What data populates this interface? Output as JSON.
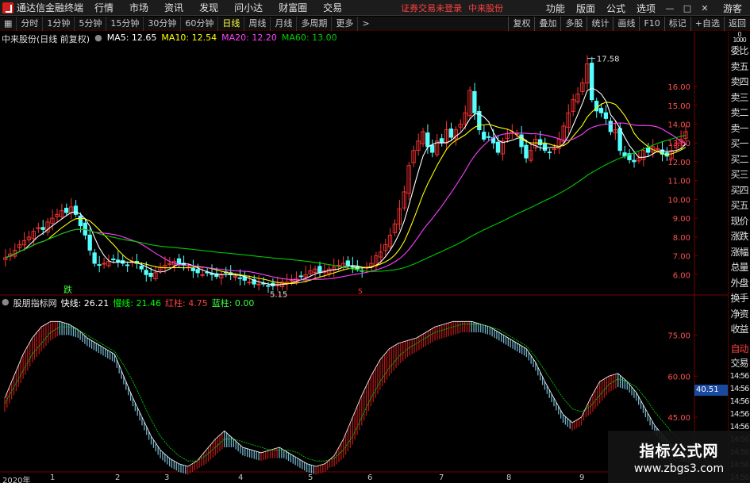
{
  "app": {
    "title": "通达信金融终端"
  },
  "menu": [
    "行情",
    "市场",
    "资讯",
    "发现",
    "问小达",
    "财富圈",
    "交易"
  ],
  "notice": {
    "account": "证券交易未登录",
    "stock": "中来股份"
  },
  "right_menu": [
    "功能",
    "版面",
    "公式",
    "选项"
  ],
  "guest": "游客",
  "periods": [
    "分时",
    "1分钟",
    "5分钟",
    "15分钟",
    "30分钟",
    "60分钟",
    "日线",
    "周线",
    "月线",
    "多周期",
    "更多"
  ],
  "active_period": "日线",
  "tools": [
    "复权",
    "叠加",
    "多股",
    "统计",
    "画线",
    "F10",
    "标记",
    "+自选",
    "返回"
  ],
  "main_legend": {
    "title": "中来股份(日线 前复权)",
    "ma5": "MA5: 12.65",
    "ma10": "MA10: 12.54",
    "ma20": "MA20: 12.20",
    "ma60": "MA60: 13.00"
  },
  "sub_legend": {
    "title": "股朋指标网",
    "fast": "快线: 26.21",
    "slow": "慢线: 21.46",
    "red": "红柱: 4.75",
    "blue": "蓝柱: 0.00"
  },
  "annotations": {
    "high": "17.58",
    "low": "5.15",
    "fall": "跌",
    "s_mark": "S"
  },
  "price_box": "40.51",
  "side_panel": {
    "top": "委比",
    "items": [
      "卖五",
      "卖四",
      "卖三",
      "卖二",
      "卖一",
      "买一",
      "买二",
      "买三",
      "买四",
      "买五",
      "现价",
      "涨跌",
      "涨幅",
      "总量",
      "外盘",
      "换手",
      "净资",
      "收益"
    ],
    "sub": [
      "自动",
      "交易",
      "14:56",
      "14:56",
      "14:56",
      "14:56",
      "14:56",
      "14:56",
      "14:56",
      "14:56",
      "14:56"
    ]
  },
  "side_top_values": [
    "0",
    "1000"
  ],
  "x_labels": [
    "2020年",
    "1",
    "2",
    "3",
    "4",
    "5",
    "6",
    "7",
    "8",
    "9"
  ],
  "watermark": {
    "title": "指标公式网",
    "url": "www.zbgs3.com"
  },
  "colors": {
    "up": "#ff3333",
    "down": "#54ffff",
    "ma5": "#ffffff",
    "ma10": "#ffff00",
    "ma20": "#ff40ff",
    "ma60": "#00cc00",
    "red_bar": "#b01818",
    "blue_bar": "#6fb0c8"
  },
  "chart_data": [
    {
      "type": "candlestick",
      "ylim": [
        5.15,
        17.58
      ],
      "y_ticks": [
        6.0,
        7.0,
        8.0,
        9.0,
        10.0,
        11.0,
        12.0,
        13.0,
        14.0,
        15.0,
        16.0
      ],
      "closes": [
        6.9,
        7.1,
        7.3,
        7.6,
        7.8,
        8.0,
        8.3,
        8.5,
        8.4,
        8.8,
        9.0,
        9.2,
        9.4,
        9.3,
        9.6,
        9.2,
        8.6,
        8.1,
        7.3,
        6.6,
        6.5,
        6.6,
        6.7,
        6.8,
        6.7,
        6.6,
        6.5,
        6.7,
        6.6,
        6.3,
        6.0,
        5.9,
        6.1,
        6.4,
        6.5,
        6.6,
        6.7,
        6.6,
        6.5,
        6.4,
        6.2,
        6.1,
        6.0,
        6.1,
        6.0,
        5.9,
        6.0,
        6.1,
        6.0,
        5.9,
        5.8,
        5.7,
        5.6,
        5.5,
        5.5,
        5.5,
        5.4,
        5.4,
        5.5,
        5.6,
        5.6,
        5.7,
        5.8,
        5.9,
        6.0,
        6.2,
        6.3,
        6.1,
        6.2,
        6.3,
        6.4,
        6.5,
        6.6,
        6.5,
        6.4,
        6.3,
        6.2,
        6.4,
        6.6,
        7.0,
        7.2,
        7.6,
        8.1,
        8.7,
        9.5,
        10.4,
        11.8,
        12.6,
        13.1,
        13.6,
        12.8,
        12.5,
        13.1,
        13.0,
        13.7,
        13.3,
        13.7,
        14.0,
        14.6,
        15.8,
        14.6,
        13.7,
        13.2,
        13.3,
        13.0,
        12.5,
        13.1,
        13.5,
        13.6,
        13.5,
        12.8,
        12.2,
        12.6,
        13.2,
        12.9,
        12.6,
        12.5,
        12.7,
        13.2,
        13.9,
        14.6,
        15.3,
        15.6,
        16.2,
        17.2,
        15.3,
        14.7,
        14.6,
        14.3,
        13.6,
        13.7,
        12.6,
        12.3,
        12.1,
        12.0,
        12.2,
        12.6,
        12.5,
        12.8,
        12.7,
        12.4,
        12.3,
        12.6,
        13.0,
        13.2,
        13.6
      ]
    },
    {
      "type": "line",
      "ylim": [
        25,
        85
      ],
      "y_ticks": [
        30.0,
        45.0,
        60.0,
        75.0
      ],
      "series": [
        {
          "name": "快线",
          "values": [
            52,
            60,
            68,
            74,
            78,
            80,
            80,
            79,
            77,
            74,
            72,
            70,
            68,
            60,
            52,
            45,
            38,
            33,
            30,
            28,
            27,
            29,
            33,
            37,
            40,
            37,
            34,
            33,
            32,
            33,
            34,
            32,
            30,
            28,
            27,
            28,
            31,
            37,
            45,
            53,
            60,
            66,
            70,
            72,
            73,
            74,
            76,
            78,
            79,
            80,
            80,
            80,
            79,
            78,
            76,
            74,
            72,
            70,
            65,
            58,
            52,
            46,
            43,
            45,
            52,
            58,
            60,
            61,
            58,
            54,
            48,
            42,
            38,
            34,
            32,
            31
          ]
        },
        {
          "name": "慢线",
          "values": [
            50,
            56,
            62,
            68,
            72,
            76,
            78,
            78,
            77,
            75,
            73,
            71,
            69,
            64,
            58,
            51,
            44,
            38,
            34,
            31,
            29,
            29,
            31,
            34,
            37,
            37,
            36,
            35,
            34,
            33,
            33,
            33,
            32,
            30,
            29,
            29,
            30,
            33,
            38,
            45,
            52,
            58,
            63,
            67,
            70,
            72,
            74,
            76,
            77,
            78,
            79,
            79,
            79,
            78,
            77,
            75,
            73,
            71,
            67,
            62,
            57,
            52,
            48,
            47,
            49,
            53,
            57,
            59,
            58,
            56,
            52,
            47,
            43,
            39,
            36,
            33
          ]
        }
      ]
    }
  ]
}
